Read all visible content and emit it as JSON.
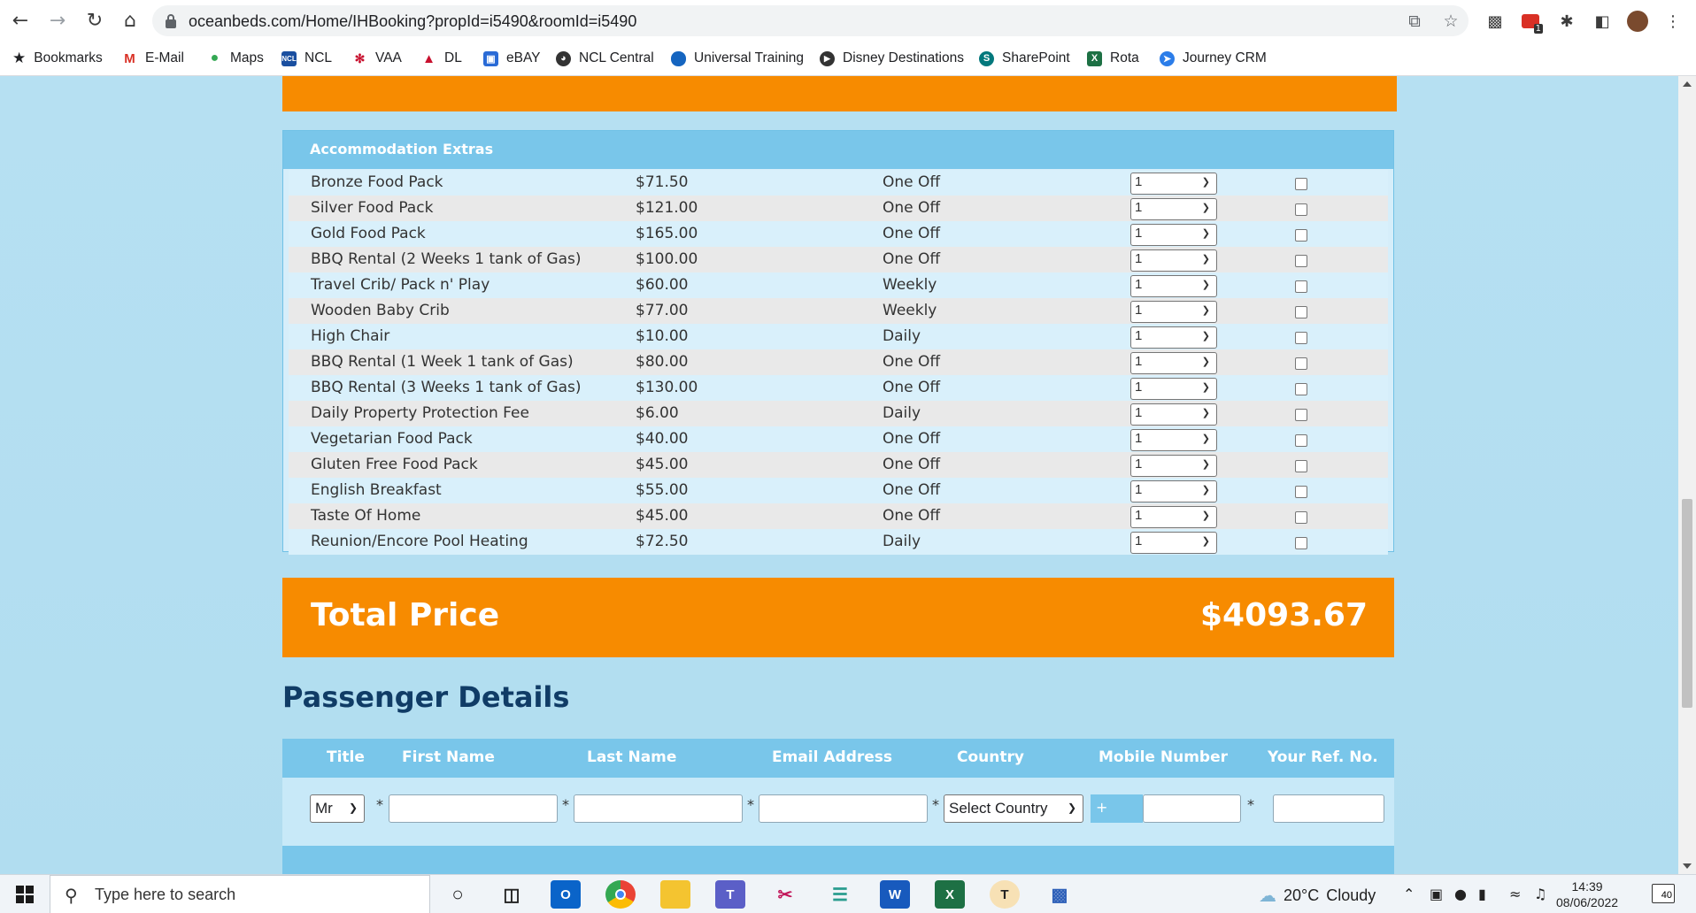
{
  "browser": {
    "url": "oceanbeds.com/Home/IHBooking?propId=i5490&roomId=i5490",
    "bookmarks": [
      {
        "label": "Bookmarks",
        "icon": "star-icon"
      },
      {
        "label": "E-Mail",
        "icon": "gmail-icon"
      },
      {
        "label": "Maps",
        "icon": "maps-icon"
      },
      {
        "label": "NCL",
        "icon": "ncl-icon"
      },
      {
        "label": "VAA",
        "icon": "vaa-icon"
      },
      {
        "label": "DL",
        "icon": "dl-icon"
      },
      {
        "label": "eBAY",
        "icon": "ebay-icon"
      },
      {
        "label": "NCL Central",
        "icon": "globe-icon"
      },
      {
        "label": "Universal Training",
        "icon": "cloud-icon"
      },
      {
        "label": "Disney Destinations",
        "icon": "play-icon"
      },
      {
        "label": "SharePoint",
        "icon": "sharepoint-icon"
      },
      {
        "label": "Rota",
        "icon": "excel-icon"
      },
      {
        "label": "Journey CRM",
        "icon": "send-icon"
      }
    ],
    "extension_badge": "1"
  },
  "extras": {
    "title": "Accommodation Extras",
    "items": [
      {
        "name": "Bronze Food Pack",
        "price": "$71.50",
        "freq": "One Off",
        "qty": "1"
      },
      {
        "name": "Silver Food Pack",
        "price": "$121.00",
        "freq": "One Off",
        "qty": "1"
      },
      {
        "name": "Gold Food Pack",
        "price": "$165.00",
        "freq": "One Off",
        "qty": "1"
      },
      {
        "name": "BBQ Rental (2 Weeks 1 tank of Gas)",
        "price": "$100.00",
        "freq": "One Off",
        "qty": "1"
      },
      {
        "name": "Travel Crib/ Pack n' Play",
        "price": "$60.00",
        "freq": "Weekly",
        "qty": "1"
      },
      {
        "name": "Wooden Baby Crib",
        "price": "$77.00",
        "freq": "Weekly",
        "qty": "1"
      },
      {
        "name": "High Chair",
        "price": "$10.00",
        "freq": "Daily",
        "qty": "1"
      },
      {
        "name": "BBQ Rental (1 Week 1 tank of Gas)",
        "price": "$80.00",
        "freq": "One Off",
        "qty": "1"
      },
      {
        "name": "BBQ Rental (3 Weeks 1 tank of Gas)",
        "price": "$130.00",
        "freq": "One Off",
        "qty": "1"
      },
      {
        "name": "Daily Property Protection Fee",
        "price": "$6.00",
        "freq": "Daily",
        "qty": "1"
      },
      {
        "name": "Vegetarian Food Pack",
        "price": "$40.00",
        "freq": "One Off",
        "qty": "1"
      },
      {
        "name": "Gluten Free Food Pack",
        "price": "$45.00",
        "freq": "One Off",
        "qty": "1"
      },
      {
        "name": "English Breakfast",
        "price": "$55.00",
        "freq": "One Off",
        "qty": "1"
      },
      {
        "name": "Taste Of Home",
        "price": "$45.00",
        "freq": "One Off",
        "qty": "1"
      },
      {
        "name": "Reunion/Encore Pool Heating",
        "price": "$72.50",
        "freq": "Daily",
        "qty": "1"
      }
    ]
  },
  "total": {
    "label": "Total Price",
    "value": "$4093.67"
  },
  "passenger": {
    "title": "Passenger Details",
    "columns": [
      "Title",
      "First Name",
      "Last Name",
      "Email Address",
      "Country",
      "Mobile Number",
      "Your Ref. No."
    ],
    "title_value": "Mr",
    "country_placeholder": "Select Country",
    "phone_prefix": "+",
    "required_mark": "*"
  },
  "taskbar": {
    "search_placeholder": "Type here to search",
    "weather_temp": "20°C",
    "weather_desc": "Cloudy",
    "time": "14:39",
    "date": "08/06/2022",
    "notification_count": "40"
  },
  "colors": {
    "accent_orange": "#f78b00",
    "header_blue": "#79c6ea",
    "page_blue": "#b3def0",
    "title_navy": "#103c66"
  }
}
